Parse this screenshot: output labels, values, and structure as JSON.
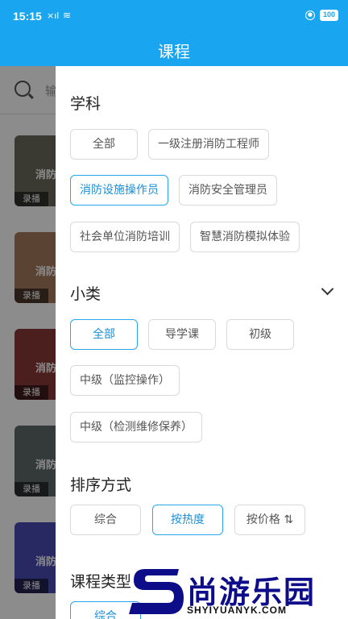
{
  "status_bar": {
    "time": "15:15",
    "signal": "×ıl",
    "wifi": "≋",
    "battery": "100"
  },
  "header": {
    "title": "课程"
  },
  "background": {
    "search_placeholder": "输",
    "cards": [
      {
        "overlay": "消防",
        "tag": "录播",
        "color": "#6b6a5c"
      },
      {
        "overlay": "消防",
        "tag": "录播",
        "color": "#a57b5e"
      },
      {
        "overlay": "消防",
        "tag": "录播",
        "color": "#8a3a3a"
      },
      {
        "overlay": "消防",
        "tag": "录播",
        "color": "#5f6b6b"
      },
      {
        "overlay": "消防",
        "tag": "录播",
        "color": "#4a4cb4"
      }
    ]
  },
  "filters": {
    "subject": {
      "title": "学科",
      "options": [
        "全部",
        "一级注册消防工程师",
        "消防设施操作员",
        "消防安全管理员",
        "社会单位消防培训",
        "智慧消防模拟体验"
      ],
      "selected": "消防设施操作员"
    },
    "subcategory": {
      "title": "小类",
      "options": [
        "全部",
        "导学课",
        "初级",
        "中级（监控操作）",
        "中级（检测维修保养）"
      ],
      "selected": "全部"
    },
    "sort": {
      "title": "排序方式",
      "options": [
        "综合",
        "按热度",
        "按价格 ⇅"
      ],
      "selected": "按热度"
    },
    "course_type": {
      "title": "课程类型",
      "options": [
        "综合"
      ],
      "selected": "综合"
    }
  },
  "watermark": {
    "brand": "尚游乐园",
    "domain": "SHYIYUANYK.COM"
  },
  "colors": {
    "primary": "#1aa5f0",
    "chip_active_border": "#2aa6ec",
    "chip_border": "#dadada"
  }
}
